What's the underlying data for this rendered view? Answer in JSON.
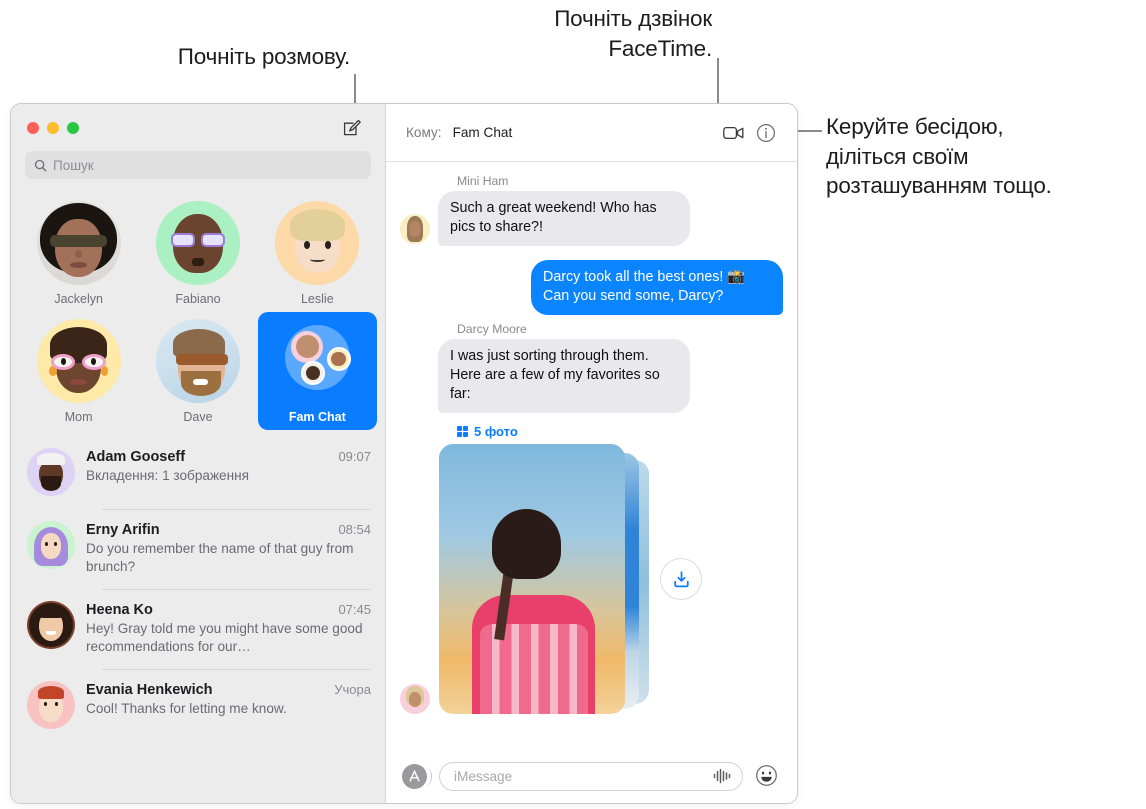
{
  "callouts": {
    "start_conversation": "Почніть розмову.",
    "facetime": "Почніть дзвінок\nFaceTime.",
    "manage": "Керуйте бесідою,\nділіться своїм\nрозташуванням тощо."
  },
  "window": {
    "traffic_lights": [
      "close",
      "minimize",
      "zoom"
    ],
    "compose_button_label": "Нова розмова"
  },
  "sidebar": {
    "search": {
      "placeholder": "Пошук",
      "value": "",
      "icon": "search-icon"
    },
    "pinned": [
      {
        "name": "Jackelyn",
        "selected": false
      },
      {
        "name": "Fabiano",
        "selected": false
      },
      {
        "name": "Leslie",
        "selected": false
      },
      {
        "name": "Mom",
        "selected": false
      },
      {
        "name": "Dave",
        "selected": false
      },
      {
        "name": "Fam Chat",
        "selected": true
      }
    ],
    "conversations": [
      {
        "name": "Adam Gooseff",
        "time": "09:07",
        "preview": "Вкладення:  1 зображення"
      },
      {
        "name": "Erny Arifin",
        "time": "08:54",
        "preview": "Do you remember the name of that guy from brunch?"
      },
      {
        "name": "Heena Ko",
        "time": "07:45",
        "preview": "Hey! Gray told me you might have some good recommendations for our…"
      },
      {
        "name": "Evania Henkewich",
        "time": "Учора",
        "preview": "Cool! Thanks for letting me know."
      }
    ]
  },
  "main": {
    "header": {
      "to_label": "Кому:",
      "to_value": "Fam Chat",
      "facetime_icon": "video-camera-icon",
      "info_icon": "info-circle-icon"
    },
    "messages": [
      {
        "sender": "Mini Ham",
        "direction": "in",
        "text": "Such a great weekend! Who has pics to share?!"
      },
      {
        "sender": "",
        "direction": "out",
        "text": "Darcy took all the best ones! 📸 Can you send some, Darcy?"
      },
      {
        "sender": "Darcy Moore",
        "direction": "in",
        "text": "I was just sorting through them. Here are a few of my favorites so far:"
      }
    ],
    "attachment": {
      "label": "5 фото",
      "grid_icon": "grid-icon",
      "download_icon": "download-icon"
    },
    "composer": {
      "apps_icon": "app-store-icon",
      "placeholder": "iMessage",
      "value": "",
      "audio_icon": "audio-waveform-icon",
      "emoji_icon": "smiley-icon"
    }
  },
  "colors": {
    "accent_blue": "#0a7cff",
    "bubble_out": "#0a84ff",
    "bubble_in": "#e8e8ed",
    "sidebar_bg": "#ececec",
    "traffic_red": "#ff5f57",
    "traffic_yellow": "#febc2e",
    "traffic_green": "#28c840"
  }
}
